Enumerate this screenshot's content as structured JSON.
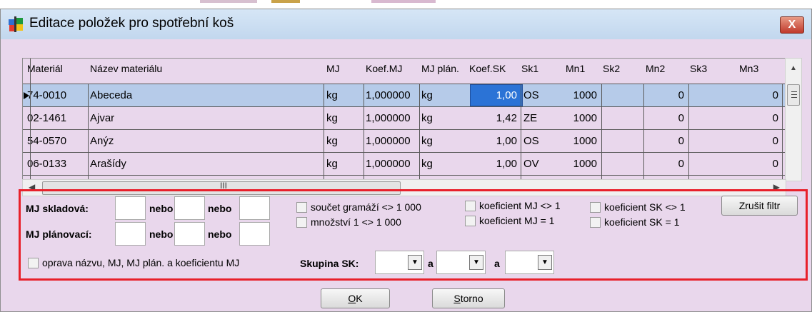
{
  "window": {
    "title": "Editace položek pro spotřební koš",
    "close_label": "X"
  },
  "grid": {
    "columns": [
      "Materiál",
      "Název materiálu",
      "MJ",
      "Koef.MJ",
      "MJ plán.",
      "Koef.SK",
      "Sk1",
      "Mn1",
      "Sk2",
      "Mn2",
      "Sk3",
      "Mn3"
    ],
    "rows": [
      [
        "74-0010",
        "Abeceda",
        "kg",
        "1,000000",
        "kg",
        "1,00",
        "OS",
        "1000",
        "",
        "0",
        "",
        "0"
      ],
      [
        "02-1461",
        "Ajvar",
        "kg",
        "1,000000",
        "kg",
        "1,42",
        "ZE",
        "1000",
        "",
        "0",
        "",
        "0"
      ],
      [
        "54-0570",
        "Anýz",
        "kg",
        "1,000000",
        "kg",
        "1,00",
        "OS",
        "1000",
        "",
        "0",
        "",
        "0"
      ],
      [
        "06-0133",
        "Arašídy",
        "kg",
        "1,000000",
        "kg",
        "1,00",
        "OV",
        "1000",
        "",
        "0",
        "",
        "0"
      ]
    ],
    "hscroll_grip": "III"
  },
  "filter": {
    "mj_skladova_label": "MJ skladová:",
    "mj_planovaci_label": "MJ plánovací:",
    "nebo1": "nebo",
    "nebo2": "nebo",
    "nebo3": "nebo",
    "nebo4": "nebo",
    "soucet_gramazi": "součet gramáží <> 1 000",
    "mnozstvi": "množství 1 <> 1 000",
    "koef_mj_ne": "koeficient MJ <> 1",
    "koef_mj_eq": "koeficient MJ = 1",
    "koef_sk_ne": "koeficient SK <> 1",
    "koef_sk_eq": "koeficient SK = 1",
    "zrusit_filtr": "Zrušit filtr",
    "oprava_nazvu": "oprava názvu, MJ, MJ plán. a koeficientu MJ",
    "skupina_sk_label": "Skupina SK:",
    "a1": "a",
    "a2": "a"
  },
  "buttons": {
    "ok_mnemonic": "O",
    "ok_rest": "K",
    "storno_mnemonic": "S",
    "storno_rest": "torno"
  },
  "colors": {
    "window_bg": "#e9d7ec",
    "selected_row": "#b6cbe9",
    "edit_cell": "#2b73d6",
    "filter_border": "#e8202a"
  }
}
